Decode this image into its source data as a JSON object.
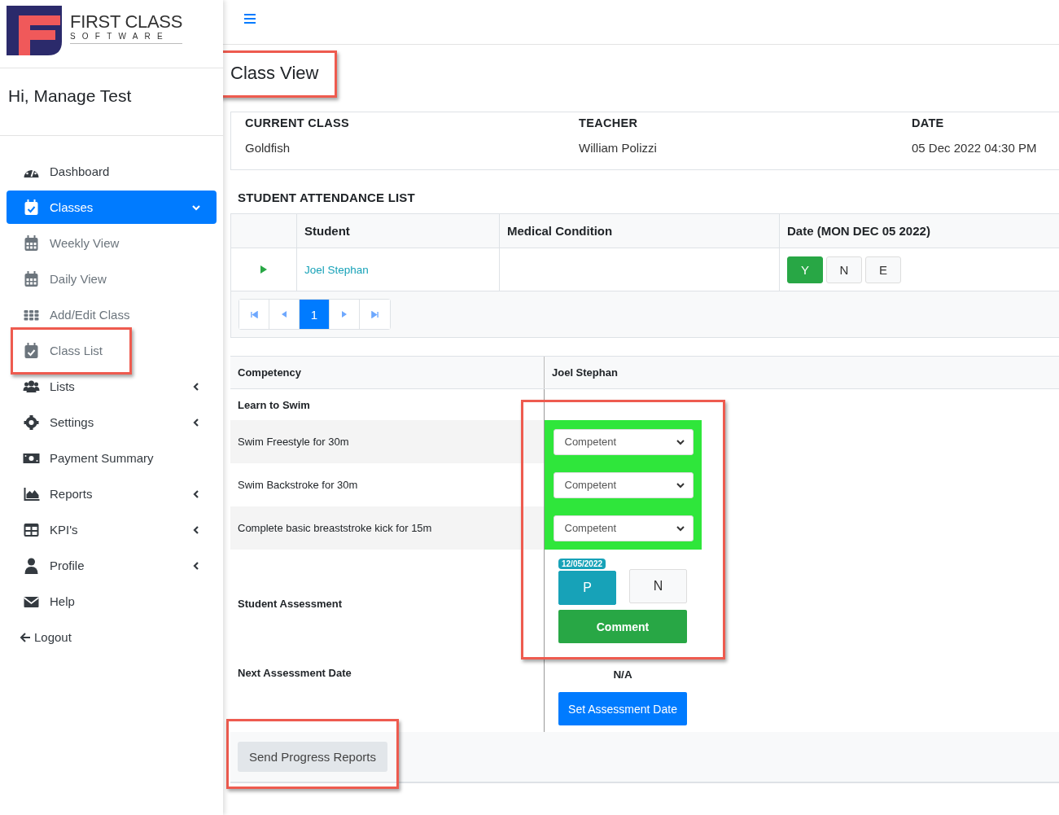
{
  "logo": {
    "name": "FIRST CLASS",
    "tagline": "SOFTWARE"
  },
  "greeting": "Hi, Manage Test",
  "sidebar": {
    "items": [
      {
        "label": "Dashboard",
        "selected": false
      },
      {
        "label": "Classes",
        "selected": true,
        "expanded": true,
        "children": [
          {
            "label": "Weekly View",
            "highlighted": false
          },
          {
            "label": "Daily View",
            "highlighted": false
          },
          {
            "label": "Add/Edit Class",
            "highlighted": false
          },
          {
            "label": "Class List",
            "highlighted": true
          }
        ]
      },
      {
        "label": "Lists",
        "selected": false,
        "expanded": false
      },
      {
        "label": "Settings",
        "selected": false,
        "expanded": false
      },
      {
        "label": "Payment Summary",
        "selected": false
      },
      {
        "label": "Reports",
        "selected": false,
        "expanded": false
      },
      {
        "label": "KPI's",
        "selected": false,
        "expanded": false
      },
      {
        "label": "Profile",
        "selected": false,
        "expanded": false
      },
      {
        "label": "Help",
        "selected": false
      }
    ],
    "logout": "Logout"
  },
  "page_title": {
    "text": "Class View",
    "highlighted": true
  },
  "class_info": [
    {
      "label": "CURRENT CLASS",
      "value": "Goldfish"
    },
    {
      "label": "TEACHER",
      "value": "William Polizzi"
    },
    {
      "label": "DATE",
      "value": "05 Dec 2022 04:30 PM"
    }
  ],
  "attendance": {
    "title": "STUDENT ATTENDANCE LIST",
    "columns": [
      "Student",
      "Medical Condition",
      "Date (MON DEC 05 2022)"
    ],
    "rows": [
      {
        "student": "Joel Stephan",
        "options": [
          {
            "label": "Y",
            "selected": true
          },
          {
            "label": "N",
            "selected": false
          },
          {
            "label": "E",
            "selected": false
          }
        ]
      }
    ],
    "pages": [
      {
        "label": "1",
        "selected": true
      }
    ]
  },
  "competency": {
    "columns": [
      "Competency",
      "Joel Stephan"
    ],
    "group": "Learn to Swim",
    "results_highlighted": true,
    "results_marked": true,
    "skills": [
      {
        "skill": "Swim Freestyle for 30m",
        "result": "Competent"
      },
      {
        "skill": "Swim Backstroke for 30m",
        "result": "Competent"
      },
      {
        "skill": "Complete basic breaststroke kick for 15m",
        "result": "Competent"
      }
    ],
    "assessment": {
      "label": "Student Assessment",
      "date_badge": "12/05/2022",
      "options": [
        {
          "label": "P",
          "selected": true
        },
        {
          "label": "N",
          "selected": false
        }
      ],
      "comment_button": "Comment"
    },
    "next_assessment": {
      "label": "Next Assessment Date",
      "value": "N/A",
      "button": "Set Assessment Date"
    }
  },
  "send_button": {
    "label": "Send Progress Reports",
    "highlighted": true
  }
}
